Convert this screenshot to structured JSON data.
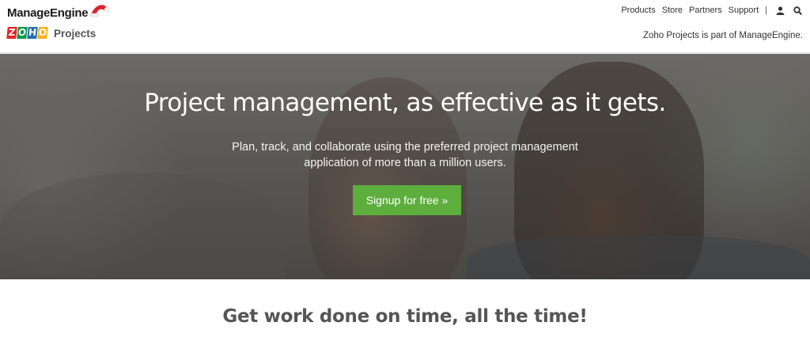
{
  "header": {
    "brand": "ManageEngine",
    "zoho_letters": [
      "Z",
      "O",
      "H",
      "O"
    ],
    "product": "Projects",
    "nav": [
      "Products",
      "Store",
      "Partners",
      "Support"
    ],
    "separator": "|",
    "icons": [
      "user-icon",
      "search-icon"
    ],
    "tagline": "Zoho Projects is part of ManageEngine."
  },
  "hero": {
    "title": "Project management, as effective as it gets.",
    "subtitle": "Plan, track, and collaborate using the preferred project management application of more than a million users.",
    "cta_label": "Signup for free »",
    "cta_color": "#5eae3e"
  },
  "section": {
    "heading": "Get work done on time, all the time!"
  }
}
